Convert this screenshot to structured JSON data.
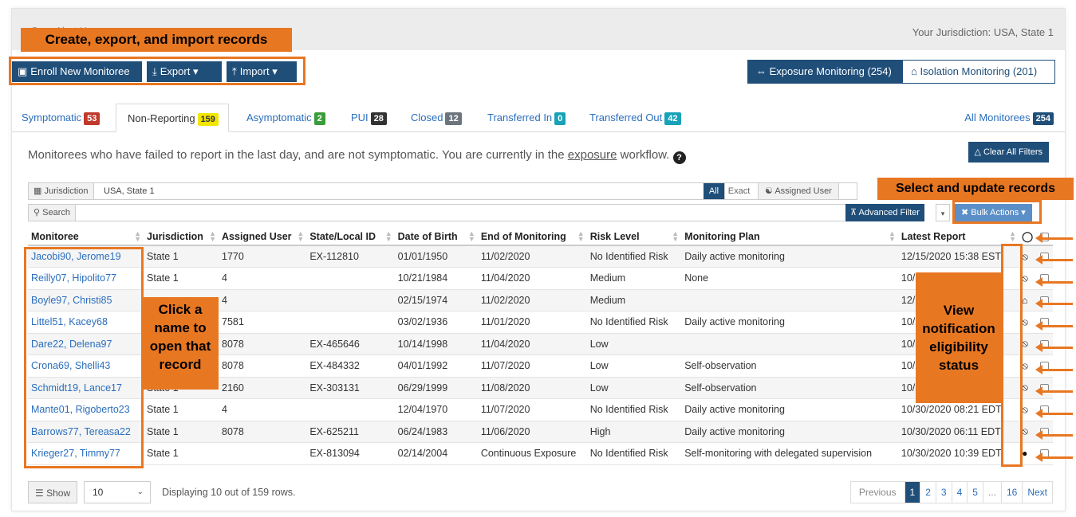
{
  "header": {
    "brand": "Sara Alert Home",
    "jurisdiction": "Your Jurisdiction: USA, State 1"
  },
  "actions": {
    "enroll": "Enroll New Monitoree",
    "export": "Export",
    "import": "Import"
  },
  "workflows": {
    "exposure": "Exposure Monitoring (254)",
    "isolation": "Isolation Monitoring (201)"
  },
  "tabs": [
    {
      "label": "Symptomatic",
      "count": "53"
    },
    {
      "label": "Non-Reporting",
      "count": "159"
    },
    {
      "label": "Asymptomatic",
      "count": "2"
    },
    {
      "label": "PUI",
      "count": "28"
    },
    {
      "label": "Closed",
      "count": "12"
    },
    {
      "label": "Transferred In",
      "count": "0"
    },
    {
      "label": "Transferred Out",
      "count": "42"
    },
    {
      "label": "All Monitorees",
      "count": "254"
    }
  ],
  "description": {
    "before": "Monitorees who have failed to report in the last day, and are not symptomatic. You are currently in the ",
    "link": "exposure",
    "after": " workflow."
  },
  "filters": {
    "clear_all": "Clear All Filters",
    "jurisdiction_label": "Jurisdiction",
    "jurisdiction_value": "USA, State 1",
    "all": "All",
    "exact": "Exact",
    "assigned_user": "Assigned User",
    "search": "Search",
    "advanced": "Advanced Filter",
    "bulk": "Bulk Actions"
  },
  "table": {
    "columns": [
      "Monitoree",
      "Jurisdiction",
      "Assigned User",
      "State/Local ID",
      "Date of Birth",
      "End of Monitoring",
      "Risk Level",
      "Monitoring Plan",
      "Latest Report"
    ],
    "rows": [
      {
        "name": "Jacobi90, Jerome19",
        "jurisdiction": "State 1",
        "user": "1770",
        "id": "EX-112810",
        "dob": "01/01/1950",
        "end": "11/02/2020",
        "risk": "No Identified Risk",
        "plan": "Daily active monitoring",
        "latest": "12/15/2020 15:38 EST",
        "notify": "bell-slash-icon"
      },
      {
        "name": "Reilly07, Hipolito77",
        "jurisdiction": "State 1",
        "user": "4",
        "id": "",
        "dob": "10/21/1984",
        "end": "11/04/2020",
        "risk": "Medium",
        "plan": "None",
        "latest": "10/30",
        "notify": "bell-slash-icon"
      },
      {
        "name": "Boyle97, Christi85",
        "jurisdiction": "",
        "user": "4",
        "id": "",
        "dob": "02/15/1974",
        "end": "11/02/2020",
        "risk": "Medium",
        "plan": "",
        "latest": "12/15",
        "notify": "house-icon"
      },
      {
        "name": "Littel51, Kacey68",
        "jurisdiction": "",
        "user": "7581",
        "id": "",
        "dob": "03/02/1936",
        "end": "11/01/2020",
        "risk": "No Identified Risk",
        "plan": "Daily active monitoring",
        "latest": "10/29",
        "notify": "bell-slash-icon"
      },
      {
        "name": "Dare22, Delena97",
        "jurisdiction": "",
        "user": "8078",
        "id": "EX-465646",
        "dob": "10/14/1998",
        "end": "11/04/2020",
        "risk": "Low",
        "plan": "",
        "latest": "10/30",
        "notify": "bell-slash-icon"
      },
      {
        "name": "Crona69, Shelli43",
        "jurisdiction": "",
        "user": "8078",
        "id": "EX-484332",
        "dob": "04/01/1992",
        "end": "11/07/2020",
        "risk": "Low",
        "plan": "Self-observation",
        "latest": "10/29",
        "notify": "bell-slash-icon"
      },
      {
        "name": "Schmidt19, Lance17",
        "jurisdiction": "State 1",
        "user": "2160",
        "id": "EX-303131",
        "dob": "06/29/1999",
        "end": "11/08/2020",
        "risk": "Low",
        "plan": "Self-observation",
        "latest": "10/27",
        "notify": "bell-slash-icon"
      },
      {
        "name": "Mante01, Rigoberto23",
        "jurisdiction": "State 1",
        "user": "4",
        "id": "",
        "dob": "12/04/1970",
        "end": "11/07/2020",
        "risk": "No Identified Risk",
        "plan": "Daily active monitoring",
        "latest": "10/30/2020 08:21 EDT",
        "notify": "bell-slash-icon"
      },
      {
        "name": "Barrows77, Tereasa22",
        "jurisdiction": "State 1",
        "user": "8078",
        "id": "EX-625211",
        "dob": "06/24/1983",
        "end": "11/06/2020",
        "risk": "High",
        "plan": "Daily active monitoring",
        "latest": "10/30/2020 06:11 EDT",
        "notify": "bell-slash-icon"
      },
      {
        "name": "Krieger27, Timmy77",
        "jurisdiction": "State 1",
        "user": "",
        "id": "EX-813094",
        "dob": "02/14/2004",
        "end": "Continuous Exposure",
        "risk": "No Identified Risk",
        "plan": "Self-monitoring with delegated supervision",
        "latest": "10/30/2020 10:39 EDT",
        "notify": "speech-bubble-icon"
      }
    ]
  },
  "footer": {
    "show": "Show",
    "page_size": "10",
    "displaying": "Displaying 10 out of 159 rows.",
    "pages": [
      "Previous",
      "1",
      "2",
      "3",
      "4",
      "5",
      "...",
      "16",
      "Next"
    ]
  },
  "annotations": {
    "create": "Create, export, and import records",
    "select": "Select and update records",
    "click_name": "Click a name to open that record",
    "view_notify": "View notification eligibility status"
  },
  "colors": {
    "primary": "#1f4e79",
    "annotation": "#e87722",
    "link": "#2a6ebd"
  }
}
